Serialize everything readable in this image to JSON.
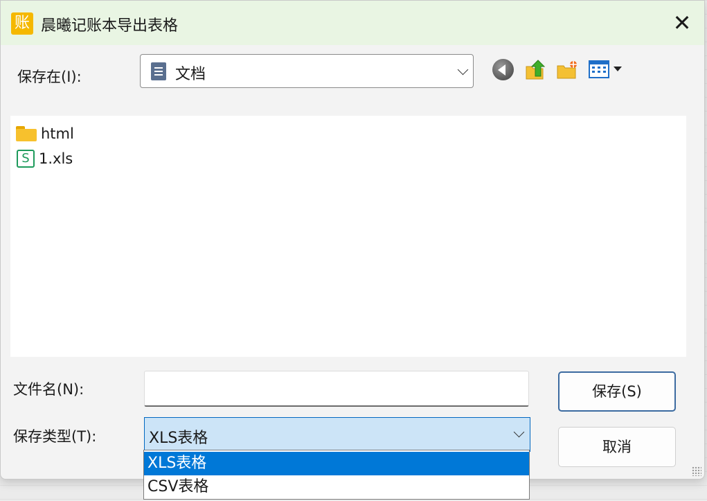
{
  "window": {
    "title": "晨曦记账本导出表格",
    "close_label": "✕",
    "logo_char": "账"
  },
  "savein": {
    "label": "保存在(I):",
    "value": "文档"
  },
  "files": [
    {
      "name": "html",
      "icon": "folder-icon"
    },
    {
      "name": "1.xls",
      "icon": "spreadsheet-icon",
      "icon_char": "S"
    }
  ],
  "filename": {
    "label": "文件名(N):",
    "value": ""
  },
  "filetype": {
    "label": "保存类型(T):",
    "value": "XLS表格",
    "options": [
      "XLS表格",
      "CSV表格"
    ],
    "selected_index": 0
  },
  "buttons": {
    "save": "保存(S)",
    "cancel": "取消"
  },
  "colors": {
    "accent": "#0078d7",
    "title_bg": "#e9f5e3",
    "logo": "#f5b800"
  }
}
